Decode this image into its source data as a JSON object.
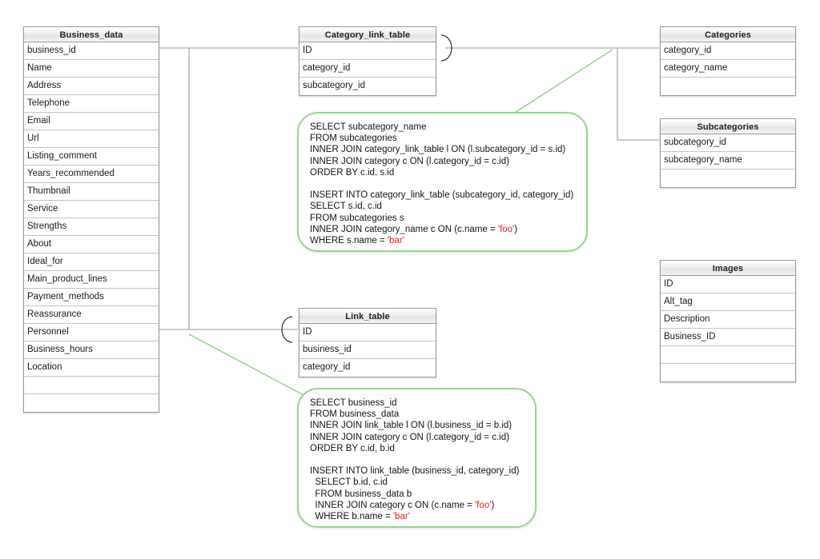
{
  "diagram": {
    "title": "Database schema diagram with SQL notes",
    "accent_green": "#96d88c",
    "literal_red": "#e8221b",
    "line_gray": "#9a9a9a"
  },
  "entities": {
    "business_data": {
      "name": "Business_data",
      "fields": [
        "business_id",
        "Name",
        "Address",
        "Telephone",
        "Email",
        "Url",
        "Listing_comment",
        "Years_recommended",
        "Thumbnail",
        "Service",
        "Strengths",
        "About",
        "Ideal_for",
        "Main_product_lines",
        "Payment_methods",
        "Reassurance",
        "Personnel",
        "Business_hours",
        "Location",
        "",
        ""
      ]
    },
    "category_link_table": {
      "name": "Category_link_table",
      "fields": [
        "ID",
        "category_id",
        "subcategory_id"
      ]
    },
    "categories": {
      "name": "Categories",
      "fields": [
        "category_id",
        "category_name",
        ""
      ]
    },
    "subcategories": {
      "name": "Subcategories",
      "fields": [
        "subcategory_id",
        "subcategory_name",
        ""
      ]
    },
    "images": {
      "name": "Images",
      "fields": [
        "ID",
        "Alt_tag",
        "Description",
        "Business_ID",
        "",
        ""
      ]
    },
    "link_table": {
      "name": "Link_table",
      "fields": [
        "ID",
        "business_id",
        "category_id"
      ]
    }
  },
  "sql_notes": {
    "category_note": {
      "select_block": [
        "SELECT subcategory_name",
        "FROM subcategories",
        "INNER JOIN category_link_table l ON (l.subcategory_id = s.id)",
        "INNER JOIN category c ON (l.category_id = c.id)",
        "ORDER BY c.id, s.id"
      ],
      "insert_block": [
        "INSERT INTO category_link_table (subcategory_id, category_id)",
        "SELECT s.id, c.id",
        "FROM subcategories s",
        "INNER JOIN category_name c ON (c.name = ",
        "WHERE s.name = "
      ],
      "literal_foo": "'foo'",
      "literal_bar": "'bar'",
      "tail_paren": ")"
    },
    "business_note": {
      "select_block": [
        "SELECT business_id",
        "FROM business_data",
        "INNER JOIN link_table l ON (l.business_id = b.id)",
        "INNER JOIN category c ON (l.category_id = c.id)",
        "ORDER BY c.id, b.id"
      ],
      "insert_block": [
        "INSERT INTO link_table (business_id, category_id)",
        "  SELECT b.id, c.id",
        "  FROM business_data b",
        "  INNER JOIN category c ON (c.name = ",
        "  WHERE b.name = "
      ],
      "literal_foo": "'foo'",
      "literal_bar": "'bar'",
      "tail_paren": ")"
    }
  }
}
